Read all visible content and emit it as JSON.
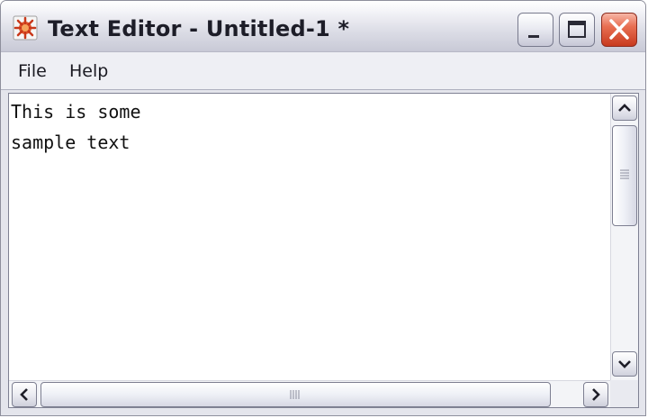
{
  "window": {
    "title": "Text Editor - Untitled-1 *",
    "app_icon": "editor-app-icon",
    "controls": {
      "minimize_icon": "minimize-icon",
      "maximize_icon": "maximize-icon",
      "close_icon": "close-icon"
    }
  },
  "menubar": {
    "items": [
      {
        "label": "File"
      },
      {
        "label": "Help"
      }
    ]
  },
  "editor": {
    "lines": [
      "This is some",
      "sample text"
    ]
  },
  "scrollbars": {
    "vertical": {
      "up_icon": "chevron-up-icon",
      "down_icon": "chevron-down-icon",
      "grip_icon": "grip-lines-icon"
    },
    "horizontal": {
      "left_icon": "chevron-left-icon",
      "right_icon": "chevron-right-icon",
      "grip_icon": "grip-lines-icon"
    }
  },
  "colors": {
    "close_button": "#e0583a",
    "titlebar": "#dcdde6"
  }
}
